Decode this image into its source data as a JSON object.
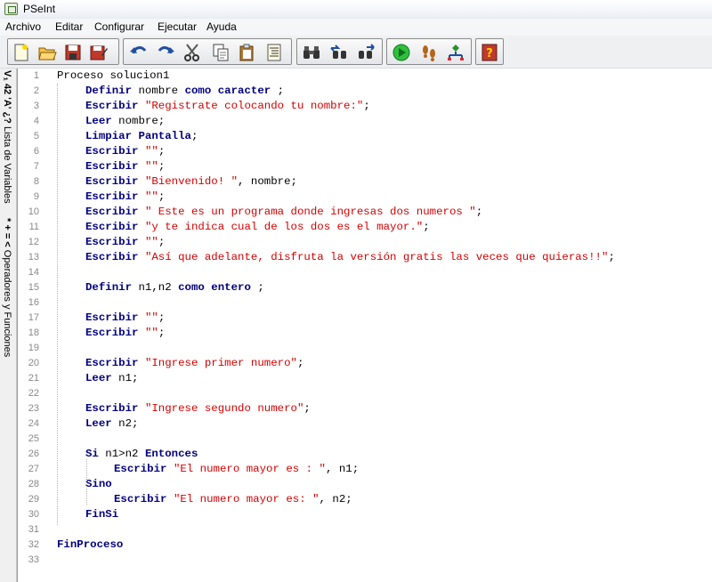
{
  "window": {
    "title": "PSeInt"
  },
  "menu": [
    "Archivo",
    "Editar",
    "Configurar",
    "Ejecutar",
    "Ayuda"
  ],
  "toolbar": {
    "buttons": [
      "new-file",
      "open-file",
      "save-file",
      "save-as",
      "undo",
      "redo",
      "cut",
      "copy",
      "paste",
      "indent",
      "find",
      "find-previous",
      "find-next",
      "run",
      "step-by-step",
      "flowchart",
      "help"
    ]
  },
  "sidebar": {
    "tab_variables": {
      "icon": "V₁ 42 'A' ¿?",
      "label": "Lista de Variables"
    },
    "tab_operators": {
      "icon": "* + = <",
      "label": "Operadores y Funciones"
    }
  },
  "editor": {
    "lines": [
      {
        "n": "1",
        "i": 0,
        "t": [
          [
            "plain",
            "Proceso solucion1"
          ]
        ]
      },
      {
        "n": "2",
        "i": 1,
        "t": [
          [
            "kw",
            "Definir"
          ],
          [
            "plain",
            " nombre "
          ],
          [
            "kw",
            "como caracter"
          ],
          [
            "plain",
            " ;"
          ]
        ]
      },
      {
        "n": "3",
        "i": 1,
        "t": [
          [
            "kw",
            "Escribir"
          ],
          [
            "plain",
            " "
          ],
          [
            "str",
            "\"Registrate colocando tu nombre:\""
          ],
          [
            "plain",
            ";"
          ]
        ]
      },
      {
        "n": "4",
        "i": 1,
        "t": [
          [
            "kw",
            "Leer"
          ],
          [
            "plain",
            " nombre;"
          ]
        ]
      },
      {
        "n": "5",
        "i": 1,
        "t": [
          [
            "kw",
            "Limpiar Pantalla"
          ],
          [
            "plain",
            ";"
          ]
        ]
      },
      {
        "n": "6",
        "i": 1,
        "t": [
          [
            "kw",
            "Escribir"
          ],
          [
            "plain",
            " "
          ],
          [
            "str",
            "\"\""
          ],
          [
            "plain",
            ";"
          ]
        ]
      },
      {
        "n": "7",
        "i": 1,
        "t": [
          [
            "kw",
            "Escribir"
          ],
          [
            "plain",
            " "
          ],
          [
            "str",
            "\"\""
          ],
          [
            "plain",
            ";"
          ]
        ]
      },
      {
        "n": "8",
        "i": 1,
        "t": [
          [
            "kw",
            "Escribir"
          ],
          [
            "plain",
            " "
          ],
          [
            "str",
            "\"Bienvenido! \""
          ],
          [
            "plain",
            ", nombre;"
          ]
        ]
      },
      {
        "n": "9",
        "i": 1,
        "t": [
          [
            "kw",
            "Escribir"
          ],
          [
            "plain",
            " "
          ],
          [
            "str",
            "\"\""
          ],
          [
            "plain",
            ";"
          ]
        ]
      },
      {
        "n": "10",
        "i": 1,
        "t": [
          [
            "kw",
            "Escribir"
          ],
          [
            "plain",
            " "
          ],
          [
            "str",
            "\" Este es un programa donde ingresas dos numeros \""
          ],
          [
            "plain",
            ";"
          ]
        ]
      },
      {
        "n": "11",
        "i": 1,
        "t": [
          [
            "kw",
            "Escribir"
          ],
          [
            "plain",
            " "
          ],
          [
            "str",
            "\"y te indica cual de los dos es el mayor.\""
          ],
          [
            "plain",
            ";"
          ]
        ]
      },
      {
        "n": "12",
        "i": 1,
        "t": [
          [
            "kw",
            "Escribir"
          ],
          [
            "plain",
            " "
          ],
          [
            "str",
            "\"\""
          ],
          [
            "plain",
            ";"
          ]
        ]
      },
      {
        "n": "13",
        "i": 1,
        "t": [
          [
            "kw",
            "Escribir"
          ],
          [
            "plain",
            " "
          ],
          [
            "str",
            "\"Así que adelante, disfruta la versión gratis las veces que quieras!!\""
          ],
          [
            "plain",
            ";"
          ]
        ]
      },
      {
        "n": "14",
        "i": 0,
        "t": []
      },
      {
        "n": "15",
        "i": 1,
        "t": [
          [
            "kw",
            "Definir"
          ],
          [
            "plain",
            " n1,n2 "
          ],
          [
            "kw",
            "como entero"
          ],
          [
            "plain",
            " ;"
          ]
        ]
      },
      {
        "n": "16",
        "i": 0,
        "t": []
      },
      {
        "n": "17",
        "i": 1,
        "t": [
          [
            "kw",
            "Escribir"
          ],
          [
            "plain",
            " "
          ],
          [
            "str",
            "\"\""
          ],
          [
            "plain",
            ";"
          ]
        ]
      },
      {
        "n": "18",
        "i": 1,
        "t": [
          [
            "kw",
            "Escribir"
          ],
          [
            "plain",
            " "
          ],
          [
            "str",
            "\"\""
          ],
          [
            "plain",
            ";"
          ]
        ]
      },
      {
        "n": "19",
        "i": 0,
        "t": []
      },
      {
        "n": "20",
        "i": 1,
        "t": [
          [
            "kw",
            "Escribir"
          ],
          [
            "plain",
            " "
          ],
          [
            "str",
            "\"Ingrese primer numero\""
          ],
          [
            "plain",
            ";"
          ]
        ]
      },
      {
        "n": "21",
        "i": 1,
        "t": [
          [
            "kw",
            "Leer"
          ],
          [
            "plain",
            " n1;"
          ]
        ]
      },
      {
        "n": "22",
        "i": 0,
        "t": []
      },
      {
        "n": "23",
        "i": 1,
        "t": [
          [
            "kw",
            "Escribir"
          ],
          [
            "plain",
            " "
          ],
          [
            "str",
            "\"Ingrese segundo numero\""
          ],
          [
            "plain",
            ";"
          ]
        ]
      },
      {
        "n": "24",
        "i": 1,
        "t": [
          [
            "kw",
            "Leer"
          ],
          [
            "plain",
            " n2;"
          ]
        ]
      },
      {
        "n": "25",
        "i": 0,
        "t": []
      },
      {
        "n": "26",
        "i": 1,
        "t": [
          [
            "kw",
            "Si"
          ],
          [
            "plain",
            " n1>n2 "
          ],
          [
            "kw",
            "Entonces"
          ]
        ]
      },
      {
        "n": "27",
        "i": 2,
        "t": [
          [
            "kw",
            "Escribir"
          ],
          [
            "plain",
            " "
          ],
          [
            "str",
            "\"El numero mayor es : \""
          ],
          [
            "plain",
            ", n1;"
          ]
        ]
      },
      {
        "n": "28",
        "i": 1,
        "t": [
          [
            "kw",
            "Sino"
          ]
        ]
      },
      {
        "n": "29",
        "i": 2,
        "t": [
          [
            "kw",
            "Escribir"
          ],
          [
            "plain",
            " "
          ],
          [
            "str",
            "\"El numero mayor es: \""
          ],
          [
            "plain",
            ", n2;"
          ]
        ]
      },
      {
        "n": "30",
        "i": 1,
        "t": [
          [
            "kw",
            "FinSi"
          ]
        ]
      },
      {
        "n": "31",
        "i": 0,
        "t": []
      },
      {
        "n": "32",
        "i": 0,
        "t": [
          [
            "kw",
            "FinProceso"
          ]
        ]
      },
      {
        "n": "33",
        "i": 0,
        "t": []
      }
    ]
  }
}
